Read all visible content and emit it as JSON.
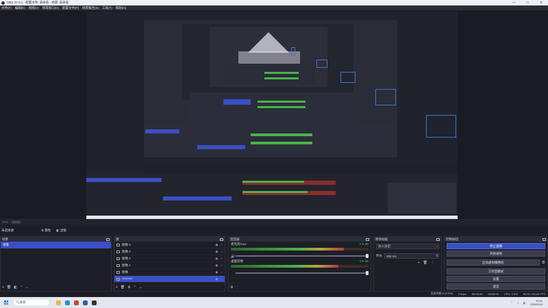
{
  "titlebar": {
    "title": "OBS 27.0.1 - 配置文件: 未命名 - 场景: 未命名",
    "controls": [
      "—",
      "□",
      "✕"
    ]
  },
  "menu": [
    "文件(F)",
    "编辑(E)",
    "视图(V)",
    "停靠窗口(D)",
    "配置文件(P)",
    "场景集合(S)",
    "工具(T)",
    "帮助(H)"
  ],
  "scene_bar": {
    "label": "????",
    "tag": "????"
  },
  "toolbar2": {
    "properties_label": "属性",
    "filters_label": "滤镜"
  },
  "scenes": {
    "title": "场景",
    "items": [
      "场景"
    ],
    "selected": 0
  },
  "sources": {
    "title": "源",
    "items": [
      {
        "name": "图像 3"
      },
      {
        "name": "图像 4"
      },
      {
        "name": "图像 2"
      },
      {
        "name": "图像 1"
      },
      {
        "name": "图像"
      },
      {
        "name": "??????"
      }
    ],
    "selected": 5
  },
  "mixer": {
    "title": "混音器",
    "channels": [
      {
        "name": "麦克风/Aux",
        "db": "0.0 dB",
        "level": 0.82
      },
      {
        "name": "桌面音频",
        "db": "0.0 dB",
        "level": 0.78
      }
    ],
    "ticks": [
      "-60",
      "-55",
      "-50",
      "-45",
      "-40",
      "-35",
      "-30",
      "-25",
      "-20",
      "-15",
      "-10",
      "-5",
      "0"
    ]
  },
  "transitions": {
    "title": "转场动画",
    "selected": "淡入淡出",
    "duration_label": "时长",
    "duration": "300 ms"
  },
  "controls": {
    "title": "控制按钮",
    "buttons": [
      "停止直播",
      "开始录制",
      "启动虚拟摄像机",
      "工作室模式",
      "设置",
      "退出"
    ]
  },
  "status": {
    "dropped": "丢弃的帧 0 (0.0%)",
    "kbps": "0 kbps",
    "live": "00:00:00",
    "rec": "00:00:00",
    "cpu": "CPU: 0.5%",
    "fps": "60.00 / 60.00 FPS"
  },
  "taskbar": {
    "search_placeholder": "搜索",
    "time": "20:11",
    "date": "2024/1/16"
  },
  "icons": {
    "gear": "gear-icon",
    "add": "plus-icon",
    "remove": "trash-icon",
    "up": "arrow-up-icon",
    "down": "arrow-down-icon",
    "eye": "eye-icon",
    "lock": "lock-icon",
    "speaker": "speaker-icon",
    "menu": "kebab-menu-icon"
  },
  "colors": {
    "accent": "#3b4fc4",
    "wire": "#3f77c8",
    "bg": "#1e1f29"
  }
}
